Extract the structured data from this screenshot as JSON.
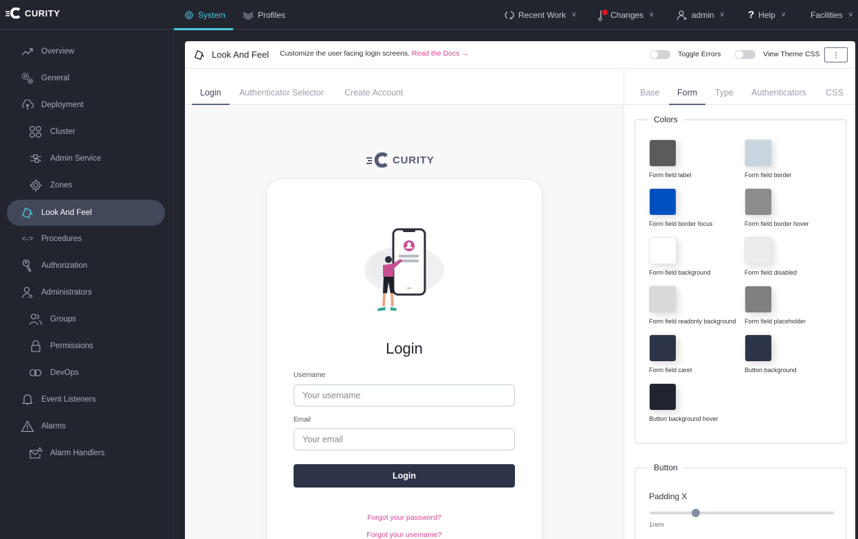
{
  "topbar": {
    "brand": "CURITY",
    "nav": [
      {
        "label": "System",
        "icon": "gear-icon",
        "active": true
      },
      {
        "label": "Profiles",
        "icon": "layers-icon",
        "active": false
      }
    ],
    "right": [
      {
        "label": "Recent Work",
        "icon": "refresh-icon"
      },
      {
        "label": "Changes",
        "icon": "changes-icon",
        "has_badge": true
      },
      {
        "label": "admin",
        "icon": "user-icon"
      },
      {
        "label": "Help",
        "icon": "help-icon"
      },
      {
        "label": "Facilities",
        "icon": ""
      }
    ]
  },
  "sidebar": {
    "items": [
      {
        "label": "Overview",
        "icon": "trend-icon",
        "level": 1
      },
      {
        "label": "General",
        "icon": "gears-icon",
        "level": 1
      },
      {
        "label": "Deployment",
        "icon": "cloud-upload-icon",
        "level": 1
      },
      {
        "label": "Cluster",
        "icon": "cluster-icon",
        "level": 2
      },
      {
        "label": "Admin Service",
        "icon": "sliders-icon",
        "level": 2
      },
      {
        "label": "Zones",
        "icon": "target-icon",
        "level": 2
      },
      {
        "label": "Look And Feel",
        "icon": "paint-bucket-icon",
        "level": 1,
        "active": true
      },
      {
        "label": "Procedures",
        "icon": "code-icon",
        "level": 1
      },
      {
        "label": "Authorization",
        "icon": "key-icon",
        "level": 1
      },
      {
        "label": "Administrators",
        "icon": "admin-user-icon",
        "level": 1
      },
      {
        "label": "Groups",
        "icon": "group-icon",
        "level": 2
      },
      {
        "label": "Permissions",
        "icon": "lock-icon",
        "level": 2
      },
      {
        "label": "DevOps",
        "icon": "infinity-icon",
        "level": 2
      },
      {
        "label": "Event Listeners",
        "icon": "bell-icon",
        "level": 1
      },
      {
        "label": "Alarms",
        "icon": "warning-icon",
        "level": 1
      },
      {
        "label": "Alarm Handlers",
        "icon": "mail-alert-icon",
        "level": 2
      }
    ]
  },
  "header": {
    "title": "Look And Feel",
    "description": "Customize the user facing login screens.",
    "docs_link": "Read the Docs →",
    "toggle_errors": "Toggle Errors",
    "toggle_errors_on": false,
    "view_theme_css": "View Theme CSS",
    "view_theme_css_on": false
  },
  "preview_tabs": [
    {
      "label": "Login",
      "active": true
    },
    {
      "label": "Authenticator Selector",
      "active": false
    },
    {
      "label": "Create Account",
      "active": false
    }
  ],
  "settings_tabs": [
    {
      "label": "Base",
      "active": false
    },
    {
      "label": "Form",
      "active": true
    },
    {
      "label": "Type",
      "active": false
    },
    {
      "label": "Authenticators",
      "active": false
    },
    {
      "label": "CSS",
      "active": false
    }
  ],
  "preview": {
    "brand": "CURITY",
    "title": "Login",
    "username_label": "Username",
    "username_placeholder": "Your username",
    "email_label": "Email",
    "email_placeholder": "Your email",
    "button": "Login",
    "forgot_password": "Forgot your password?",
    "forgot_username": "Forgot your username?"
  },
  "colors": {
    "legend": "Colors",
    "items": [
      {
        "label": "Form field label",
        "color": "#5b5b5b"
      },
      {
        "label": "Form field border",
        "color": "#c9d5de"
      },
      {
        "label": "Form field border focus",
        "color": "#0050c0"
      },
      {
        "label": "Form field border hover",
        "color": "#8c8c8c"
      },
      {
        "label": "Form field background",
        "color": "#ffffff"
      },
      {
        "label": "Form field disabled",
        "color": "#ececee"
      },
      {
        "label": "Form field readonly background",
        "color": "#d9d9da"
      },
      {
        "label": "Form field placeholder",
        "color": "#808080"
      },
      {
        "label": "Form field caret",
        "color": "#2d3447"
      },
      {
        "label": "Button background",
        "color": "#2d3447"
      },
      {
        "label": "Button background hover",
        "color": "#20242f"
      }
    ]
  },
  "button_section": {
    "legend": "Button",
    "padding_x_label": "Padding X",
    "padding_x_value": "1rem",
    "padding_x_fraction": 0.25
  }
}
